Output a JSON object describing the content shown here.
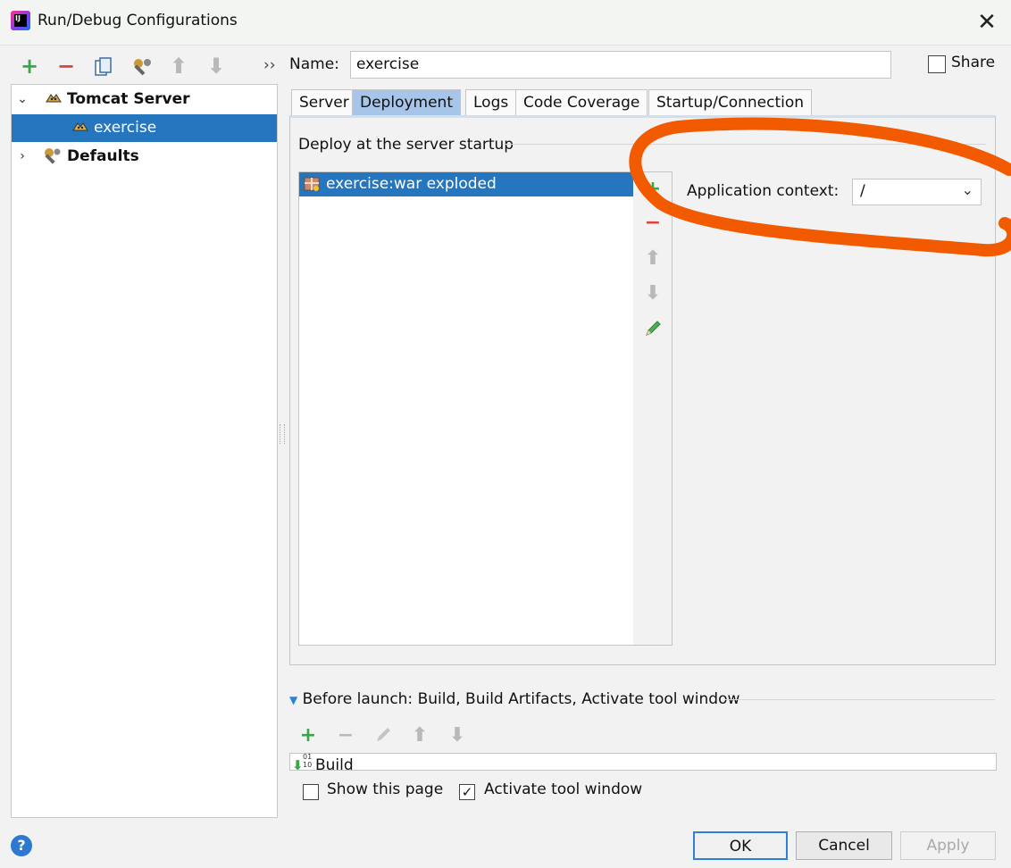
{
  "window": {
    "title": "Run/Debug Configurations",
    "app_icon_text": "IJ"
  },
  "toolbar": {
    "more_label": "››"
  },
  "tree": {
    "items": [
      {
        "label": "Tomcat Server",
        "bold": true
      },
      {
        "label": "exercise",
        "selected": true
      },
      {
        "label": "Defaults",
        "bold": true
      }
    ]
  },
  "name_field": {
    "label": "Name:",
    "value": "exercise"
  },
  "share": {
    "label": "Share",
    "checked": false
  },
  "tabs": [
    {
      "label": "Server"
    },
    {
      "label": "Deployment",
      "active": true
    },
    {
      "label": "Logs"
    },
    {
      "label": "Code Coverage"
    },
    {
      "label": "Startup/Connection"
    }
  ],
  "deployment": {
    "group_title": "Deploy at the server startup",
    "artifacts": [
      {
        "label": "exercise:war exploded"
      }
    ],
    "app_context_label": "Application context:",
    "app_context_value": "/"
  },
  "before_launch": {
    "label": "Before launch: Build, Build Artifacts, Activate tool window",
    "items": [
      {
        "label": "Build"
      }
    ]
  },
  "options": {
    "show_page_label": "Show this page",
    "show_page_checked": false,
    "activate_tool_label": "Activate tool window",
    "activate_tool_checked": true
  },
  "footer": {
    "help_label": "?",
    "ok_label": "OK",
    "cancel_label": "Cancel",
    "apply_label": "Apply"
  },
  "colors": {
    "selection": "#2675bf",
    "annotation": "#f25a00",
    "add_green": "#3aa64a",
    "remove_red": "#d9453b"
  }
}
